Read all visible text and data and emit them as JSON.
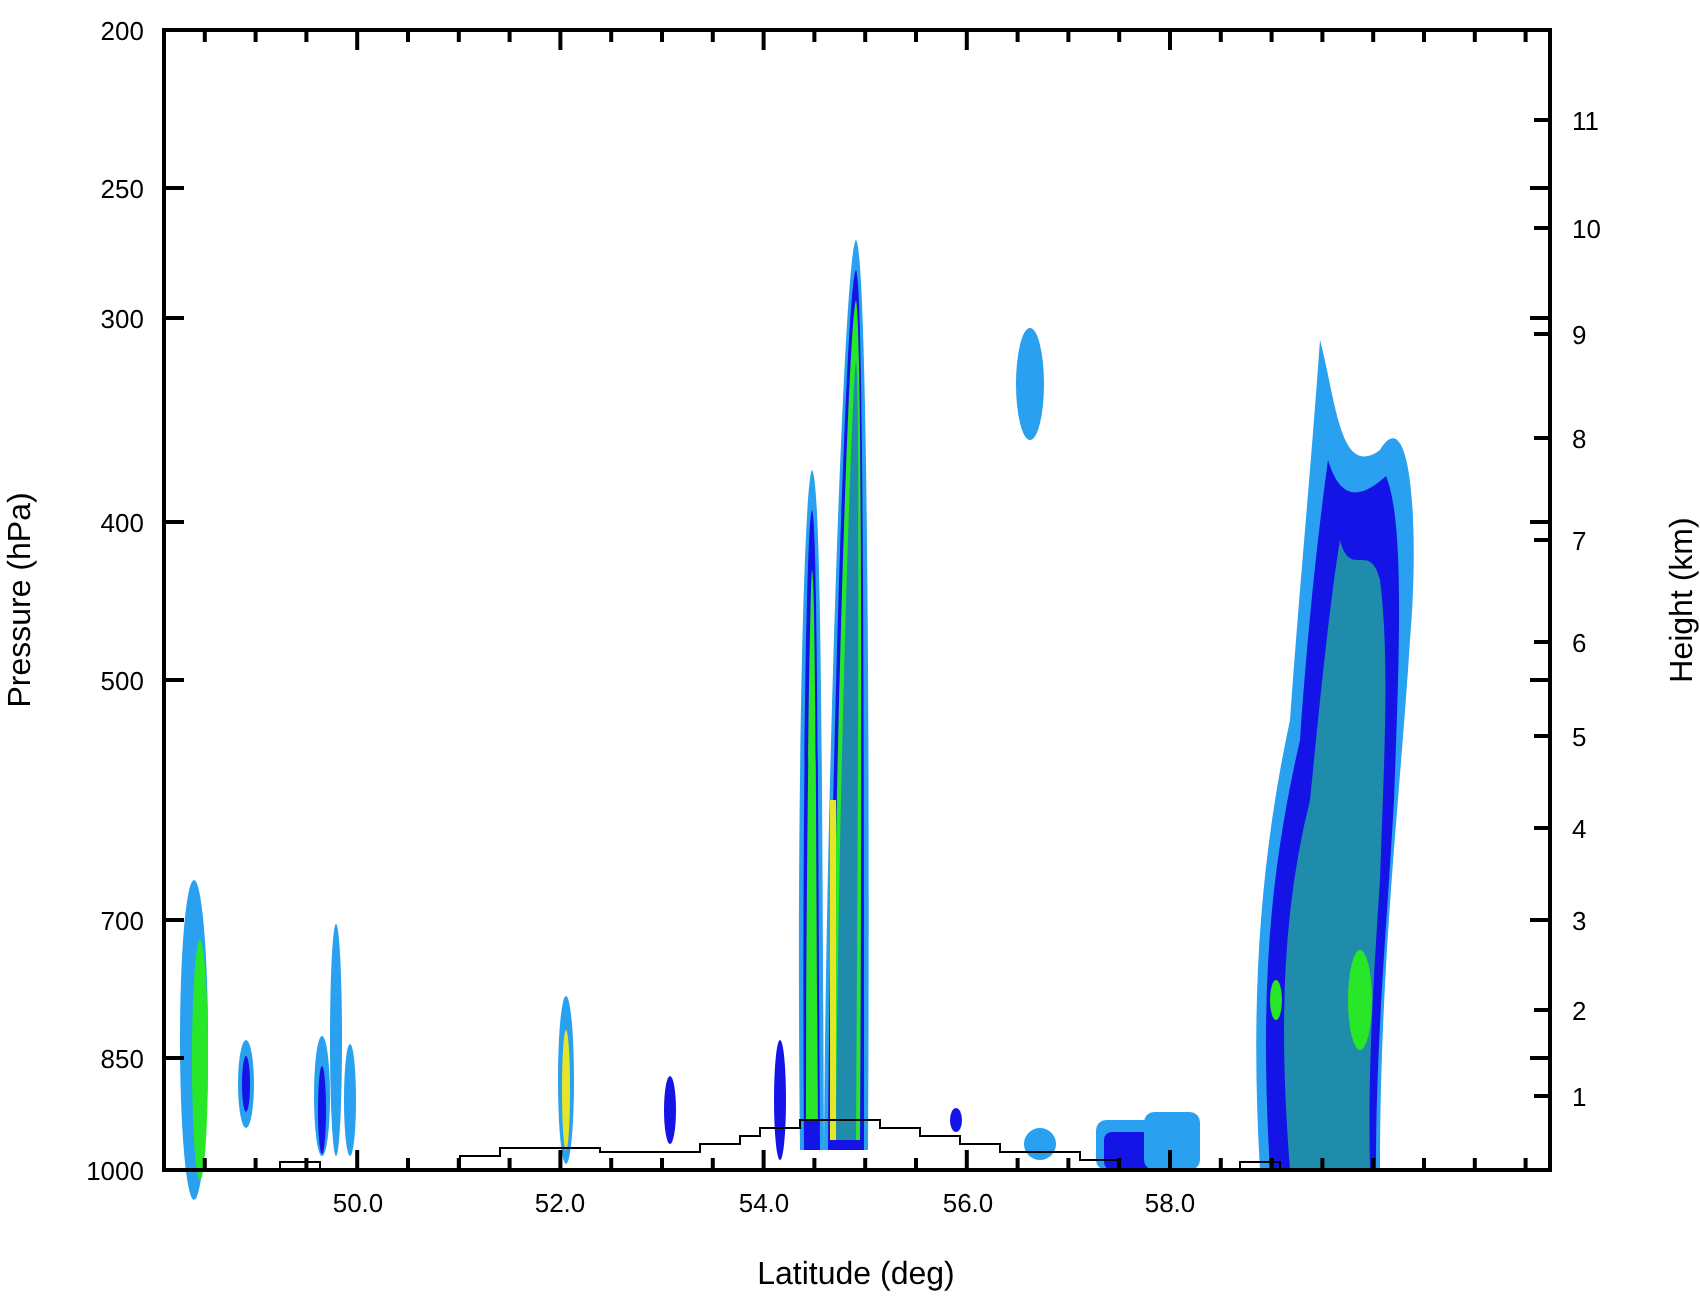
{
  "left_axis": {
    "label": "Pressure (hPa)",
    "ticks": [
      "200",
      "250",
      "300",
      "400",
      "500",
      "700",
      "850",
      "1000"
    ]
  },
  "right_axis": {
    "label": "Height (km)",
    "ticks": [
      "11",
      "10",
      "9",
      "8",
      "7",
      "6",
      "5",
      "4",
      "3",
      "2",
      "1"
    ]
  },
  "bottom_axis": {
    "label": "Latitude (deg)",
    "ticks": [
      "50.0",
      "52.0",
      "54.0",
      "56.0",
      "58.0"
    ]
  }
}
